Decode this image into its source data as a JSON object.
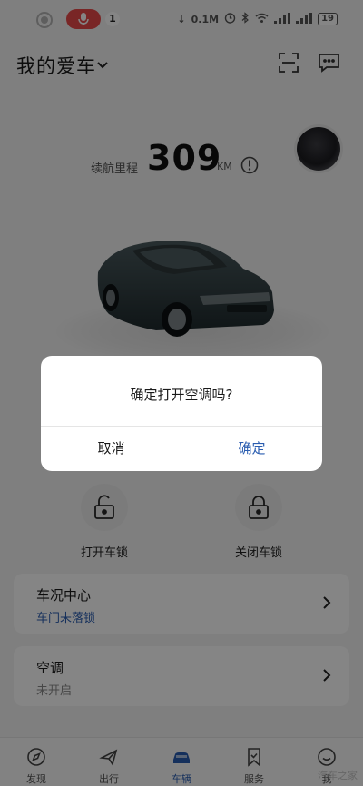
{
  "status_bar": {
    "notification_count": "1",
    "net_speed": "0.1M",
    "battery": "19",
    "icons": [
      "settings-circle-icon",
      "mic-icon",
      "alarm-icon",
      "bluetooth-icon",
      "wifi-icon",
      "signal-icon"
    ]
  },
  "header": {
    "title": "我的爱车",
    "icons": [
      "chevron-down-icon",
      "scan-icon",
      "chat-icon"
    ]
  },
  "range": {
    "label": "续航里程",
    "value": "309",
    "unit": "KM"
  },
  "actions": [
    {
      "label": "打开车锁",
      "icon": "unlock-icon"
    },
    {
      "label": "关闭车锁",
      "icon": "lock-icon"
    }
  ],
  "cards": [
    {
      "title": "车况中心",
      "subtitle": "车门未落锁",
      "subtitle_color": "#2a5db0"
    },
    {
      "title": "空调",
      "subtitle": "未开启",
      "subtitle_color": "#888888"
    }
  ],
  "bottom_nav": [
    {
      "label": "发现",
      "icon": "compass-icon",
      "active": false
    },
    {
      "label": "出行",
      "icon": "plane-icon",
      "active": false
    },
    {
      "label": "车辆",
      "icon": "car-icon",
      "active": true
    },
    {
      "label": "服务",
      "icon": "bookmark-icon",
      "active": false
    },
    {
      "label": "我",
      "icon": "smile-icon",
      "active": false
    }
  ],
  "dialog": {
    "message": "确定打开空调吗?",
    "cancel": "取消",
    "confirm": "确定"
  },
  "watermark": "汽车之家",
  "colors": {
    "accent": "#2a5db0",
    "mic": "#e84a4a",
    "overlay": "rgba(0,0,0,0.48)"
  }
}
